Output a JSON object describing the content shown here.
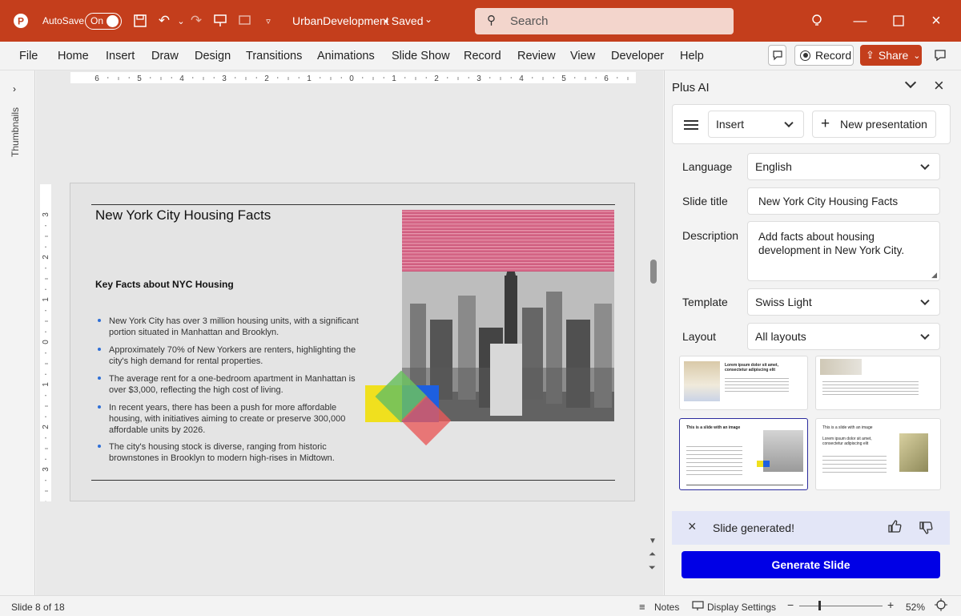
{
  "titlebar": {
    "app_icon": "powerpoint-logo",
    "autosave_label": "AutoSave",
    "autosave_state": "On",
    "doc_title": "UrbanDevelopment",
    "saved_status": "• Saved",
    "search_placeholder": "Search"
  },
  "ribbon": {
    "tabs": [
      "File",
      "Home",
      "Insert",
      "Draw",
      "Design",
      "Transitions",
      "Animations",
      "Slide Show",
      "Record",
      "Review",
      "View",
      "Developer",
      "Help"
    ],
    "record_label": "Record",
    "share_label": "Share"
  },
  "thumbnails_label": "Thumbnails",
  "rulers": {
    "h": [
      "6",
      "5",
      "4",
      "3",
      "2",
      "1",
      "0",
      "1",
      "2",
      "3",
      "4",
      "5",
      "6"
    ],
    "v": [
      "3",
      "2",
      "1",
      "0",
      "1",
      "2",
      "3"
    ]
  },
  "slide": {
    "title": "New York City Housing Facts",
    "subtitle": "Key Facts about NYC Housing",
    "bullets": [
      "New York City has over 3 million housing units, with a significant portion situated in Manhattan and Brooklyn.",
      "Approximately 70% of New Yorkers are renters, highlighting the city's high demand for rental properties.",
      "The average rent for a one-bedroom apartment in Manhattan is over $3,000, reflecting the high cost of living.",
      "In recent years, there has been a push for more affordable housing, with initiatives aiming to create or preserve 300,000 affordable units by 2026.",
      "The city's housing stock is diverse, ranging from historic brownstones in Brooklyn to modern high-rises in Midtown."
    ],
    "accent_colors": {
      "pink": "#d86b8a",
      "yellow": "#f0e01e",
      "green": "#6bbf5f",
      "blue": "#1d5fe0",
      "red": "#e85a5a"
    }
  },
  "pane": {
    "title": "Plus AI",
    "mode": "Insert",
    "new_presentation": "New presentation",
    "language_label": "Language",
    "language_value": "English",
    "slide_title_label": "Slide title",
    "slide_title_value": "New York City Housing Facts",
    "description_label": "Description",
    "description_value": "Add facts about housing development in New York City.",
    "template_label": "Template",
    "template_value": "Swiss Light",
    "layout_label": "Layout",
    "layout_value": "All layouts",
    "layout_card_text": "Lorem ipsum dolor sit amet, consectetur adipiscing elit",
    "layout_card_title": "This is a slide with an image",
    "toast": "Slide generated!",
    "generate_label": "Generate Slide",
    "accent": "#0000e6"
  },
  "status": {
    "slide_counter": "Slide 8 of 18",
    "notes": "Notes",
    "display_settings": "Display Settings",
    "zoom": "52%"
  }
}
